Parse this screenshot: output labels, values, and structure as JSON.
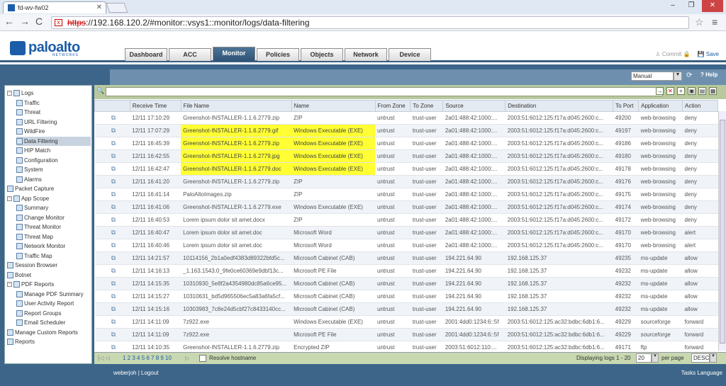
{
  "browser": {
    "tab_title": "fd-wv-fw02",
    "url_scheme": "https",
    "url_rest": "://192.168.120.2/#monitor::vsys1::monitor/logs/data-filtering"
  },
  "app": {
    "logo_text": "paloalto",
    "logo_sub": "NETWORKS",
    "tabs": [
      "Dashboard",
      "ACC",
      "Monitor",
      "Policies",
      "Objects",
      "Network",
      "Device"
    ],
    "active_tab": "Monitor",
    "commit_label": "Commit",
    "save_label": "Save"
  },
  "toolbar": {
    "refresh_mode": "Manual",
    "help_label": "Help"
  },
  "sidebar": {
    "items": [
      {
        "label": "Logs",
        "level": 0
      },
      {
        "label": "Traffic",
        "level": 1
      },
      {
        "label": "Threat",
        "level": 1
      },
      {
        "label": "URL Filtering",
        "level": 1
      },
      {
        "label": "WildFire",
        "level": 1
      },
      {
        "label": "Data Filtering",
        "level": 1,
        "selected": true
      },
      {
        "label": "HIP Match",
        "level": 1
      },
      {
        "label": "Configuration",
        "level": 1
      },
      {
        "label": "System",
        "level": 1
      },
      {
        "label": "Alarms",
        "level": 1
      },
      {
        "label": "Packet Capture",
        "level": 0
      },
      {
        "label": "App Scope",
        "level": 0
      },
      {
        "label": "Summary",
        "level": 1
      },
      {
        "label": "Change Monitor",
        "level": 1
      },
      {
        "label": "Threat Monitor",
        "level": 1
      },
      {
        "label": "Threat Map",
        "level": 1
      },
      {
        "label": "Network Monitor",
        "level": 1
      },
      {
        "label": "Traffic Map",
        "level": 1
      },
      {
        "label": "Session Browser",
        "level": 0
      },
      {
        "label": "Botnet",
        "level": 0
      },
      {
        "label": "PDF Reports",
        "level": 0
      },
      {
        "label": "Manage PDF Summary",
        "level": 1
      },
      {
        "label": "User Activity Report",
        "level": 1
      },
      {
        "label": "Report Groups",
        "level": 1
      },
      {
        "label": "Email Scheduler",
        "level": 1
      },
      {
        "label": "Manage Custom Reports",
        "level": 0
      },
      {
        "label": "Reports",
        "level": 0
      }
    ]
  },
  "table": {
    "columns": [
      "",
      "Receive Time",
      "File Name",
      "Name",
      "From Zone",
      "To Zone",
      "Source",
      "Destination",
      "To Port",
      "Application",
      "Action"
    ],
    "rows": [
      [
        "12/11 17:10:29",
        "Greenshot-INSTALLER-1.1.6.2779.zip",
        "ZIP",
        "untrust",
        "trust-user",
        "2a01:488:42:1000:...",
        "2003:51:6012:125:f17a:d045:2600:c...",
        "49200",
        "web-browsing",
        "deny"
      ],
      [
        "12/11 17:07:29",
        "Greenshot-INSTALLER-1.1.6.2779.gif",
        "Windows Executable (EXE)",
        "untrust",
        "trust-user",
        "2a01:488:42:1000:...",
        "2003:51:6012:125:f17a:d045:2600:c...",
        "49197",
        "web-browsing",
        "deny"
      ],
      [
        "12/11 16:45:39",
        "Greenshot-INSTALLER-1.1.6.2779.zip",
        "Windows Executable (EXE)",
        "untrust",
        "trust-user",
        "2a01:488:42:1000:...",
        "2003:51:6012:125:f17a:d045:2600:c...",
        "49186",
        "web-browsing",
        "deny"
      ],
      [
        "12/11 16:42:55",
        "Greenshot-INSTALLER-1.1.6.2779.jpg",
        "Windows Executable (EXE)",
        "untrust",
        "trust-user",
        "2a01:488:42:1000:...",
        "2003:51:6012:125:f17a:d045:2600:c...",
        "49180",
        "web-browsing",
        "deny"
      ],
      [
        "12/11 16:42:47",
        "Greenshot-INSTALLER-1.1.6.2779.doc",
        "Windows Executable (EXE)",
        "untrust",
        "trust-user",
        "2a01:488:42:1000:...",
        "2003:51:6012:125:f17a:d045:2600:c...",
        "49178",
        "web-browsing",
        "deny"
      ],
      [
        "12/11 16:41:20",
        "Greenshot-INSTALLER-1.1.6.2779.zip",
        "ZIP",
        "untrust",
        "trust-user",
        "2a01:488:42:1000:...",
        "2003:51:6012:125:f17a:d045:2600:c...",
        "49176",
        "web-browsing",
        "deny"
      ],
      [
        "12/11 16:41:14",
        "PaloAltoImages.zip",
        "ZIP",
        "untrust",
        "trust-user",
        "2a01:488:42:1000:...",
        "2003:51:6012:125:f17a:d045:2600:c...",
        "49175",
        "web-browsing",
        "deny"
      ],
      [
        "12/11 16:41:06",
        "Greenshot-INSTALLER-1.1.6.2779.exe",
        "Windows Executable (EXE)",
        "untrust",
        "trust-user",
        "2a01:488:42:1000:...",
        "2003:51:6012:125:f17a:d045:2600:c...",
        "49174",
        "web-browsing",
        "deny"
      ],
      [
        "12/11 16:40:53",
        "Lorem ipsum dolor sit amet.docx",
        "ZIP",
        "untrust",
        "trust-user",
        "2a01:488:42:1000:...",
        "2003:51:6012:125:f17a:d045:2600:c...",
        "49172",
        "web-browsing",
        "deny"
      ],
      [
        "12/11 16:40:47",
        "Lorem ipsum dolor sit amet.doc",
        "Microsoft Word",
        "untrust",
        "trust-user",
        "2a01:488:42:1000:...",
        "2003:51:6012:125:f17a:d045:2600:c...",
        "49170",
        "web-browsing",
        "alert"
      ],
      [
        "12/11 16:40:46",
        "Lorem ipsum dolor sit amet.doc",
        "Microsoft Word",
        "untrust",
        "trust-user",
        "2a01:488:42:1000:...",
        "2003:51:6012:125:f17a:d045:2600:c...",
        "49170",
        "web-browsing",
        "alert"
      ],
      [
        "12/11 14:21:57",
        "10114156_2b1a0edf4383d89322bfd5c...",
        "Microsoft Cabinet (CAB)",
        "untrust",
        "trust-user",
        "194.221.64.90",
        "192.168.125.37",
        "49235",
        "ms-update",
        "allow"
      ],
      [
        "12/11 14:16:13",
        "_1.163.1543.0_9fe0ce60369e9dbf13c...",
        "Microsoft PE File",
        "untrust",
        "trust-user",
        "194.221.64.90",
        "192.168.125.37",
        "49232",
        "ms-update",
        "allow"
      ],
      [
        "12/11 14:15:35",
        "10310930_5e8f2a4354980dc85a6ce95...",
        "Microsoft Cabinet (CAB)",
        "untrust",
        "trust-user",
        "194.221.64.90",
        "192.168.125.37",
        "49232",
        "ms-update",
        "allow"
      ],
      [
        "12/11 14:15:27",
        "10310631_bd5d965506ec5a83a6fa5cf...",
        "Microsoft Cabinet (CAB)",
        "untrust",
        "trust-user",
        "194.221.64.90",
        "192.168.125.37",
        "49232",
        "ms-update",
        "allow"
      ],
      [
        "12/11 14:15:16",
        "10303983_7c8e24d5cbf27c8433140cc...",
        "Microsoft Cabinet (CAB)",
        "untrust",
        "trust-user",
        "194.221.64.90",
        "192.168.125.37",
        "49232",
        "ms-update",
        "allow"
      ],
      [
        "12/11 14:11:09",
        "7z922.exe",
        "Windows Executable (EXE)",
        "untrust",
        "trust-user",
        "2001:4dd0:1234:6::5f",
        "2003:51:6012:125:ac32:bdbc:6db1:6...",
        "49229",
        "sourceforge",
        "forward"
      ],
      [
        "12/11 14:11:09",
        "7z922.exe",
        "Microsoft PE File",
        "untrust",
        "trust-user",
        "2001:4dd0:1234:6::5f",
        "2003:51:6012:125:ac32:bdbc:6db1:6...",
        "49229",
        "sourceforge",
        "forward"
      ],
      [
        "12/11 14:10:35",
        "Greenshot-INSTALLER-1.1.6.2779.zip",
        "Encrypted ZIP",
        "untrust",
        "trust-user",
        "2003:51:6012:110:...",
        "2003:51:6012:125:ac32:bdbc:6db1:6...",
        "49171",
        "ftp",
        "forward"
      ]
    ],
    "highlight_rows": [
      1,
      2,
      3,
      4
    ]
  },
  "pager": {
    "pages": "1 2 3 4 5 6 7 8 9 10",
    "resolve_label": "Resolve hostname",
    "displaying": "Displaying logs 1 - 20",
    "per_page_value": "20",
    "per_page_label": "per page",
    "sort": "DESC"
  },
  "footer": {
    "user": "weberjoh",
    "logout": "Logout",
    "tasks": "Tasks",
    "language": "Language"
  }
}
